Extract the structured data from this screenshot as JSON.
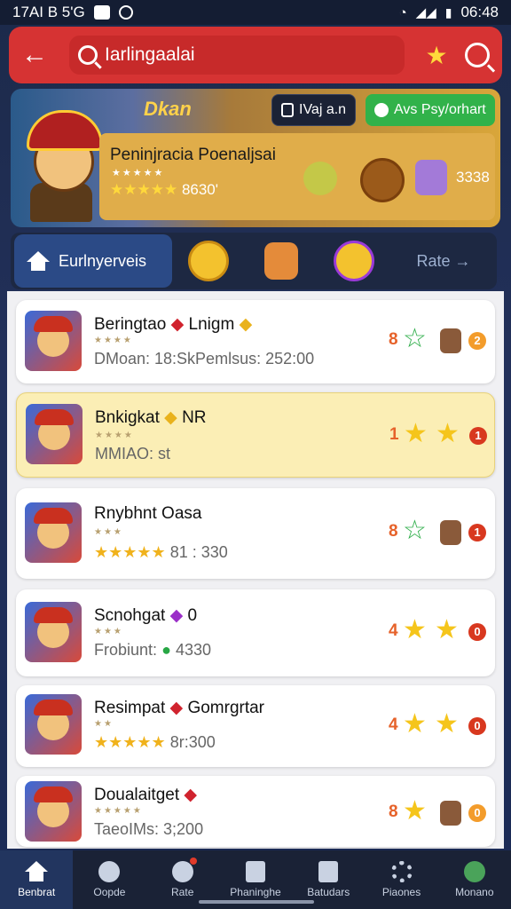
{
  "status_bar": {
    "time_left": "17AI B 5'G",
    "time_right": "06:48"
  },
  "header": {
    "search_text": "Iarlingaalai"
  },
  "banner": {
    "brand": "Dkan",
    "chip_dark": "IVaj a.n",
    "chip_green": "Avs Psy/orhart",
    "card_title": "Peninjracia Poenaljsai",
    "card_mini_stars": "★★★★★",
    "card_rating_stars": "★★★★★",
    "card_rating_value": "8630'",
    "card_count": "3338"
  },
  "nav": {
    "home_label": "Eurlnyerveis",
    "rate_label": "Rate →"
  },
  "rows": [
    {
      "name": "Beringtao",
      "name_tail": "Lnigm",
      "mini": "★★★★",
      "meta": "DMoan: 18:SkPemlsus: 252:00",
      "rank": "8",
      "badge": "2"
    },
    {
      "name": "Bnkigkat",
      "name_tail": "NR",
      "mini": "★★★★",
      "meta": "MMIAO: st",
      "rank": "1",
      "badge": "1"
    },
    {
      "name": "Rnybhnt Oasa",
      "name_tail": "",
      "mini": "★★★",
      "meta_stars": "★★★★★",
      "meta": "81 : 330",
      "rank": "8",
      "badge": "1"
    },
    {
      "name": "Scnohgat",
      "name_tail": "0",
      "mini": "★★★",
      "meta": "Frobiunt:",
      "meta2": "4330",
      "rank": "4",
      "badge": "0"
    },
    {
      "name": "Resimpat",
      "name_tail": "Gomrgrtar",
      "mini": "★★",
      "meta_stars": "★★★★★",
      "meta": "8r:300",
      "rank": "4",
      "badge": "0"
    },
    {
      "name": "Doualaitget",
      "name_tail": "",
      "mini": "★★★★★",
      "meta": "TaeoIMs: 3;200",
      "rank": "8",
      "badge": "0"
    }
  ],
  "bottom_nav": [
    {
      "label": "Benbrat"
    },
    {
      "label": "Oopde"
    },
    {
      "label": "Rate"
    },
    {
      "label": "Phaninghe"
    },
    {
      "label": "Batudars"
    },
    {
      "label": "Piaones"
    },
    {
      "label": "Monano"
    }
  ]
}
